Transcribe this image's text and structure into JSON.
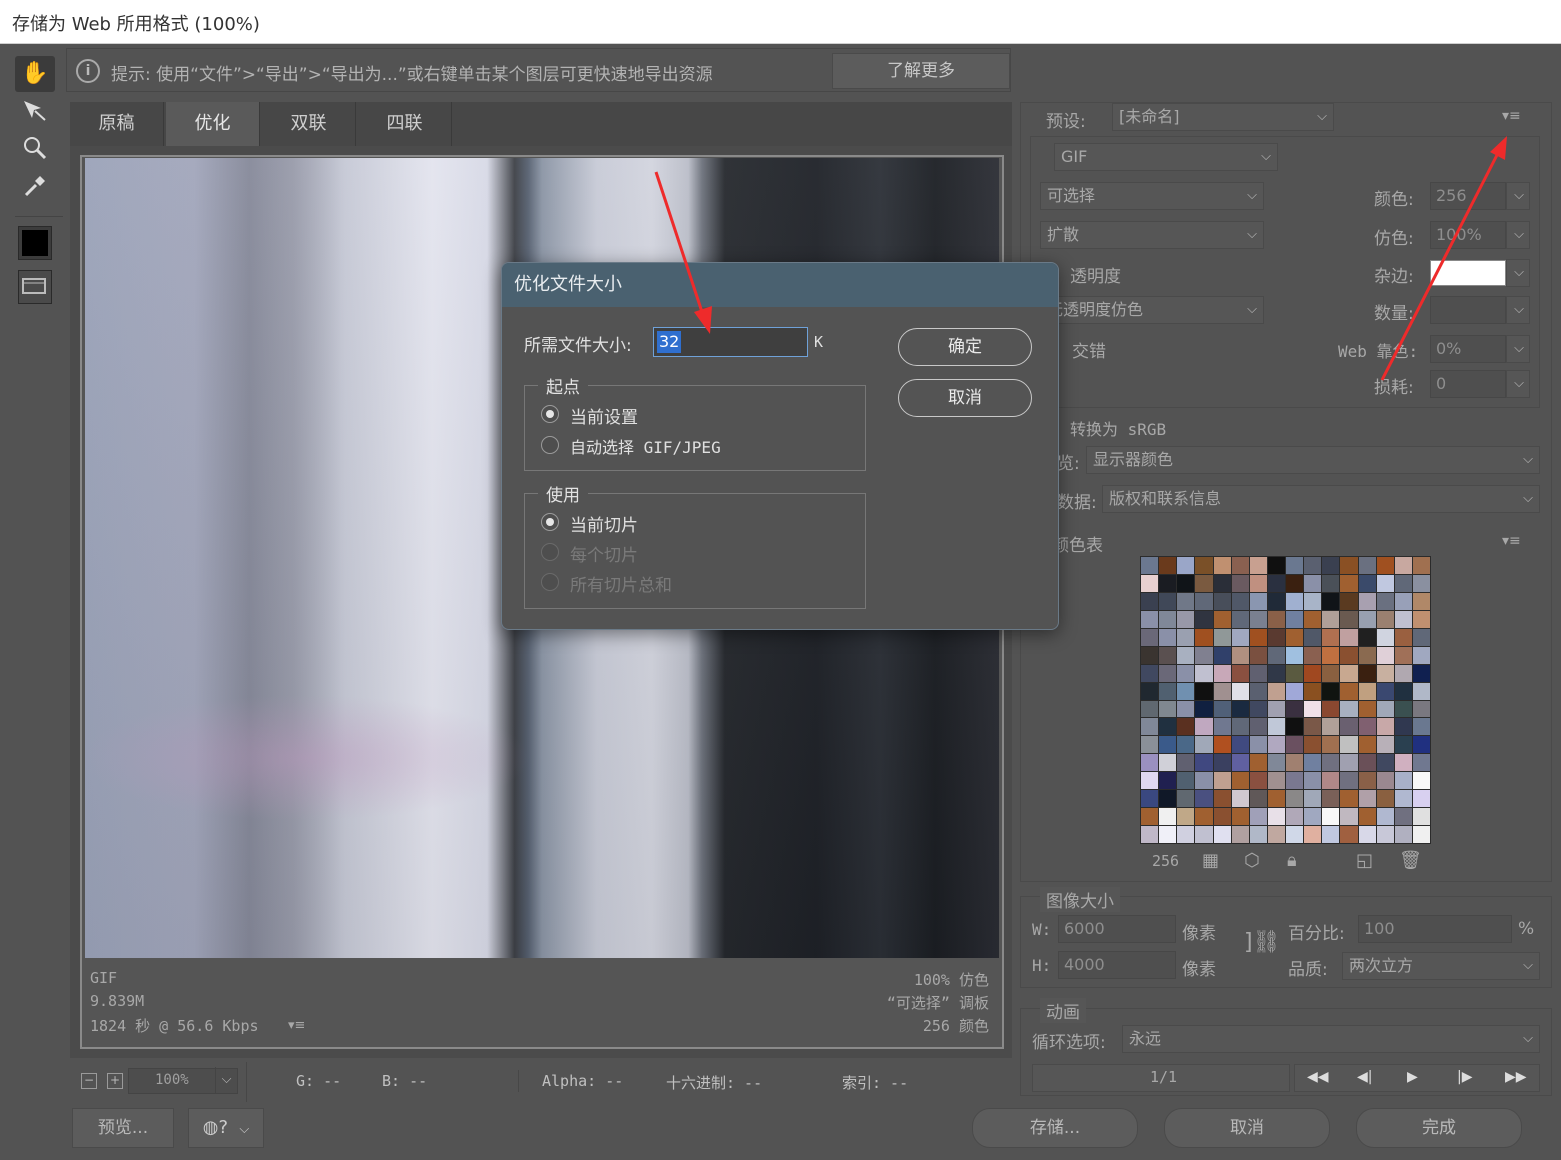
{
  "window": {
    "title": "存储为 Web 所用格式 (100%)"
  },
  "hint": {
    "text": "提示: 使用“文件”>“导出”>“导出为...”或右键单击某个图层可更快速地导出资源",
    "learn_more": "了解更多"
  },
  "tabs": [
    "原稿",
    "优化",
    "双联",
    "四联"
  ],
  "active_tab": "优化",
  "image_info": {
    "format": "GIF",
    "size": "9.839M",
    "time": "1824 秒 @ 56.6 Kbps",
    "dither": "100% 仿色",
    "palette": "“可选择” 调板",
    "colors": "256 颜色"
  },
  "statusbar": {
    "zoom": "100%",
    "g": "G: --",
    "b": "B: --",
    "alpha": "Alpha: --",
    "hex": "十六进制: --",
    "index": "索引: --"
  },
  "bottom_buttons": {
    "preview": "预览...",
    "save": "存储...",
    "cancel": "取消",
    "done": "完成"
  },
  "settings": {
    "preset_label": "预设:",
    "preset_value": "[未命名]",
    "format": "GIF",
    "reduction": "可选择",
    "dither_algo": "扩散",
    "transparency": "透明度",
    "matte_dither": "无透明度仿色",
    "interlace": "交错",
    "colors_label": "颜色:",
    "colors_value": "256",
    "dither_label": "仿色:",
    "dither_value": "100%",
    "matte_label": "杂边:",
    "amount_label": "数量:",
    "websnap_label": "Web 靠色:",
    "websnap_value": "0%",
    "lossy_label": "损耗:",
    "lossy_value": "0",
    "convert_srgb": "转换为 sRGB",
    "preview_label": "预览:",
    "preview_value": "显示器颜色",
    "metadata_label": "元数据:",
    "metadata_value": "版权和联系信息",
    "color_table_label": "颜色表",
    "color_count": "256"
  },
  "image_size": {
    "title": "图像大小",
    "w_label": "W:",
    "w_value": "6000",
    "h_label": "H:",
    "h_value": "4000",
    "unit": "像素",
    "percent_label": "百分比:",
    "percent_value": "100",
    "percent_unit": "%",
    "quality_label": "品质:",
    "quality_value": "两次立方"
  },
  "animation": {
    "title": "动画",
    "loop_label": "循环选项:",
    "loop_value": "永远",
    "frame": "1/1"
  },
  "dialog": {
    "title": "优化文件大小",
    "size_label": "所需文件大小:",
    "size_value": "32",
    "size_unit": "K",
    "ok": "确定",
    "cancel": "取消",
    "start_group": "起点",
    "start_options": [
      "当前设置",
      "自动选择 GIF/JPEG"
    ],
    "use_group": "使用",
    "use_options": [
      "当前切片",
      "每个切片",
      "所有切片总和"
    ]
  },
  "palette_colors": [
    "#6b7890",
    "#6a3a1c",
    "#9aa6c8",
    "#7a5028",
    "#c09070",
    "#8a6050",
    "#c8a090",
    "#101010",
    "#6a7890",
    "#5a6070",
    "#3a4050",
    "#8a5024",
    "#6a7080",
    "#a05020",
    "#c8a8a0",
    "#a07050",
    "#e8d0d0",
    "#1a1c22",
    "#101418",
    "#7a5a40",
    "#2a2e38",
    "#6a5a60",
    "#c09080",
    "#2a3040",
    "#3a2010",
    "#8a90a8",
    "#4a5058",
    "#a06030",
    "#3a4a6a",
    "#c0c8e0",
    "#606878",
    "#8a90a0",
    "#3a4050",
    "#404858",
    "#707888",
    "#606878",
    "#484e5a",
    "#505868",
    "#8a96b0",
    "#202a38",
    "#a0b0d0",
    "#a8b4c8",
    "#101418",
    "#5a3a20",
    "#a8a0b0",
    "#6a7080",
    "#98a0b8",
    "#b08868",
    "#8a90a8",
    "#808898",
    "#9898a8",
    "#303440",
    "#a06030",
    "#606878",
    "#7a8090",
    "#8a6048",
    "#7080a0",
    "#a06030",
    "#b0a098",
    "#6a5a50",
    "#98a0b0",
    "#9a8070",
    "#c0c0d0",
    "#c09070",
    "#6a6878",
    "#8a90a8",
    "#9aa0b0",
    "#a05020",
    "#909898",
    "#a0a8c0",
    "#a05020",
    "#5a3a30",
    "#a06030",
    "#505868",
    "#b07050",
    "#c0a0a0",
    "#202020",
    "#d0d4e0",
    "#9a6040",
    "#606878",
    "#3a3430",
    "#5a5050",
    "#a8b0c0",
    "#808090",
    "#30406a",
    "#b09080",
    "#7a5040",
    "#606878",
    "#a0c0e0",
    "#8a6050",
    "#c07040",
    "#8a5030",
    "#8a6a50",
    "#e0d0d8",
    "#a07058",
    "#a0a8c0",
    "#404860",
    "#6a6878",
    "#8a90a8",
    "#c0c0d0",
    "#c8a8b8",
    "#8a5040",
    "#606070",
    "#303848",
    "#5a5a40",
    "#a04820",
    "#8a6040",
    "#c8a890",
    "#3a2010",
    "#c8b0a0",
    "#b0a8b0",
    "#102050",
    "#202830",
    "#506070",
    "#7090b0",
    "#101010",
    "#a09090",
    "#e0e0e8",
    "#5a6070",
    "#c0a090",
    "#a0a8d8",
    "#8a5020",
    "#101410",
    "#a06030",
    "#c0a080",
    "#3a4870",
    "#203040",
    "#b0b8c8",
    "#606870",
    "#808890",
    "#8a90a8",
    "#102040",
    "#506078",
    "#1a2a40",
    "#404860",
    "#a0a0b0",
    "#3a3040",
    "#f0e0e8",
    "#8a4830",
    "#a8b0c0",
    "#a06030",
    "#a0a8b8",
    "#3a5050",
    "#7a7880",
    "#808898",
    "#203040",
    "#5a3020",
    "#c0a8c0",
    "#707890",
    "#606878",
    "#606070",
    "#c0c8d8",
    "#101010",
    "#7a5848",
    "#b0a098",
    "#6a6070",
    "#806070",
    "#c8a8a8",
    "#303850",
    "#6a7890",
    "#8a9098",
    "#3a5a8a",
    "#4a6888",
    "#a0a8b8",
    "#b05020",
    "#404a80",
    "#8a90a8",
    "#b0a8c0",
    "#6a5060",
    "#8a5030",
    "#a07050",
    "#c0c0c0",
    "#a06030",
    "#b8b0b8",
    "#2a4050",
    "#203080",
    "#9a90c0",
    "#d0d0d8",
    "#606070",
    "#404880",
    "#3a4060",
    "#6060a0",
    "#a06030",
    "#808898",
    "#a08070",
    "#7080a0",
    "#707080",
    "#a0a0b0",
    "#6a5058",
    "#404860",
    "#d0b0c0",
    "#707890",
    "#e0d8f0",
    "#202050",
    "#506070",
    "#8a90a8",
    "#c0a090",
    "#a06030",
    "#8a5040",
    "#a09090",
    "#7a7890",
    "#8a90a8",
    "#b08888",
    "#707080",
    "#8a6048",
    "#9a8890",
    "#a8b0c8",
    "#f8f8f8",
    "#3a4880",
    "#101828",
    "#606870",
    "#4a5080",
    "#8a5030",
    "#d0c8d0",
    "#605858",
    "#a06030",
    "#8a8888",
    "#a0a8b8",
    "#7a6058",
    "#a06030",
    "#b0a0a8",
    "#8a6040",
    "#b0b8d0",
    "#d8d0f0",
    "#a06030",
    "#f0f0f0",
    "#c0a888",
    "#a06030",
    "#8a5030",
    "#a06030",
    "#a0a0b8",
    "#e8e0e8",
    "#b0a8b8",
    "#a0a8c0",
    "#f8f8f8",
    "#c0b8c0",
    "#a06030",
    "#b0b8d0",
    "#707080",
    "#e0e0e0",
    "#c0b8c8",
    "#f0f0f8",
    "#d0d0e0",
    "#c0c0d0",
    "#e0e0f0",
    "#b0a0a0",
    "#b0b8c8",
    "#c0a8a0",
    "#d0d8e8",
    "#e0b0a0",
    "#c0c8e0",
    "#a06040",
    "#d8d8e8",
    "#c8c8d8",
    "#b0b0c0",
    "#f0f0f0"
  ]
}
